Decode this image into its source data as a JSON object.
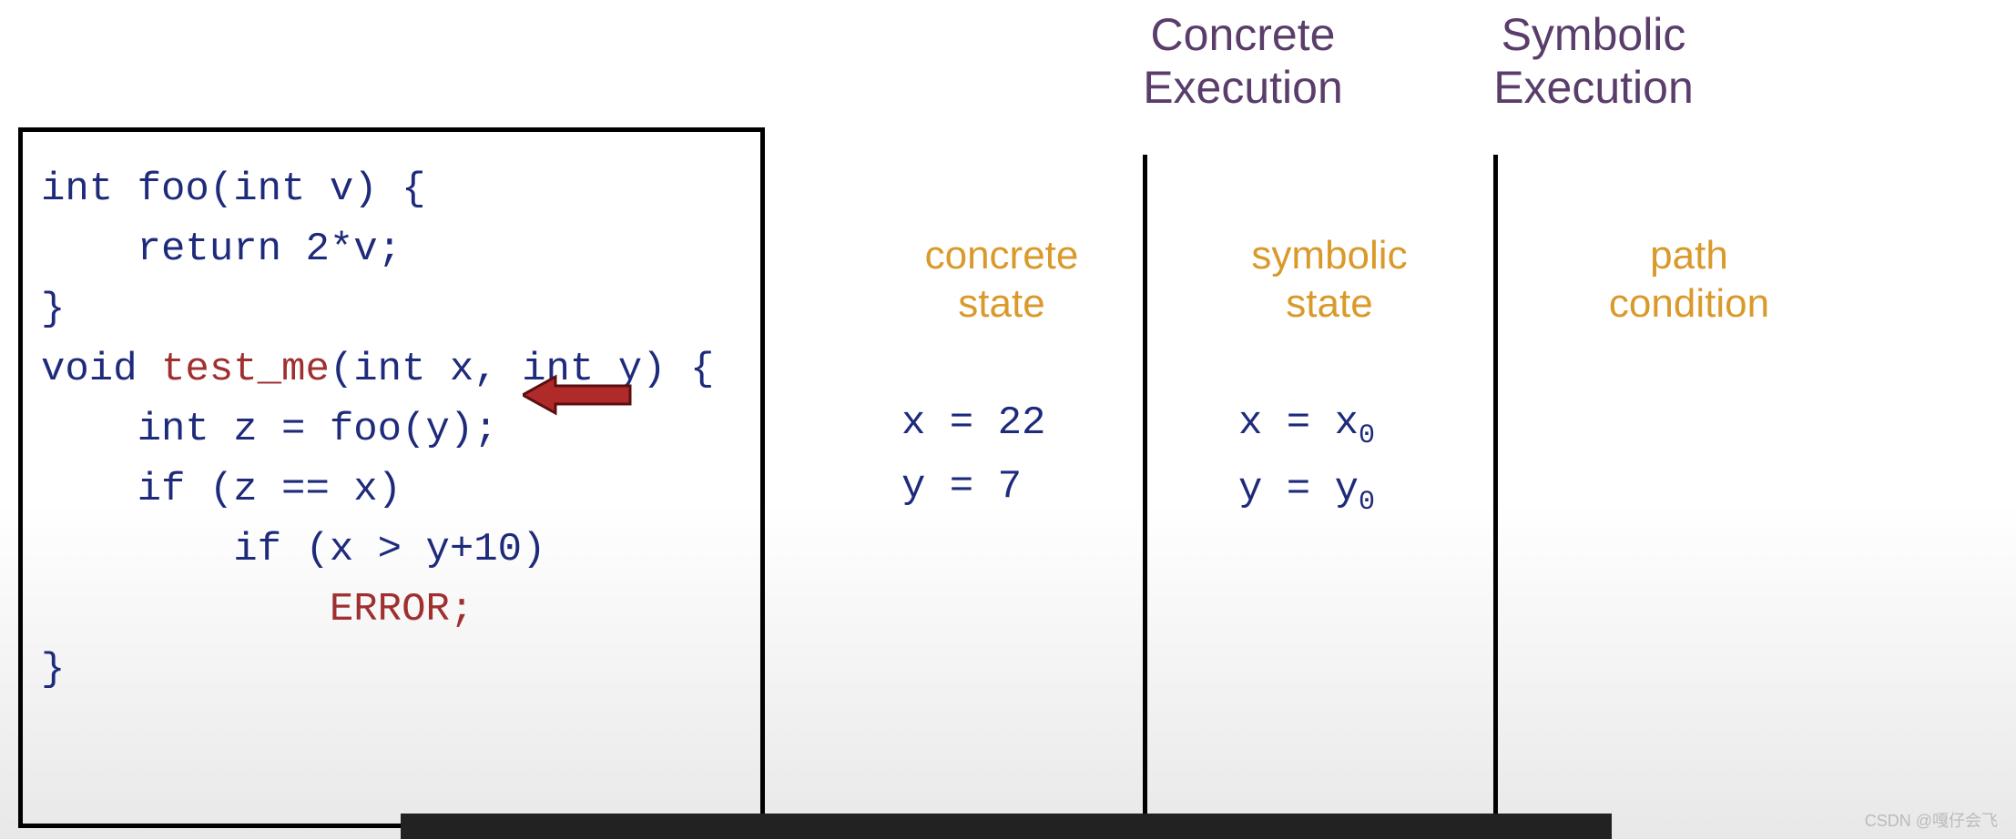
{
  "code": {
    "foo_sig": "int foo(int v) {",
    "foo_body": "    return 2*v;",
    "foo_end": "}",
    "blank": "",
    "test_sig_pre": "void ",
    "test_sig_fn": "test_me",
    "test_sig_post": "(int x, int y) {",
    "l_z": "    int z = foo(y);",
    "l_if1": "    if (z == x)",
    "l_if2": "        if (x > y+10)",
    "l_err_indent": "            ",
    "l_err": "ERROR;",
    "test_end": "}"
  },
  "headers": {
    "concrete_title1": "Concrete",
    "concrete_title2": "Execution",
    "symbolic_title1": "Symbolic",
    "symbolic_title2": "Execution"
  },
  "labels": {
    "concrete_state1": "concrete",
    "concrete_state2": "state",
    "symbolic_state1": "symbolic",
    "symbolic_state2": "state",
    "path_cond1": "path",
    "path_cond2": "condition"
  },
  "concrete_state": {
    "x": "x = 22",
    "y": "y = 7"
  },
  "symbolic_state": {
    "x_pre": "x = x",
    "x_sub": "0",
    "y_pre": "y = y",
    "y_sub": "0"
  },
  "path_condition": "",
  "watermark": "CSDN @嘎仔会飞",
  "chart_data": {
    "type": "table",
    "title": "Concolic execution initial state",
    "columns": [
      "concrete state",
      "symbolic state",
      "path condition"
    ],
    "rows": [
      {
        "concrete state": "x = 22",
        "symbolic state": "x = x0",
        "path condition": ""
      },
      {
        "concrete state": "y = 7",
        "symbolic state": "y = y0",
        "path condition": ""
      }
    ],
    "current_line": "int z = foo(y);"
  }
}
